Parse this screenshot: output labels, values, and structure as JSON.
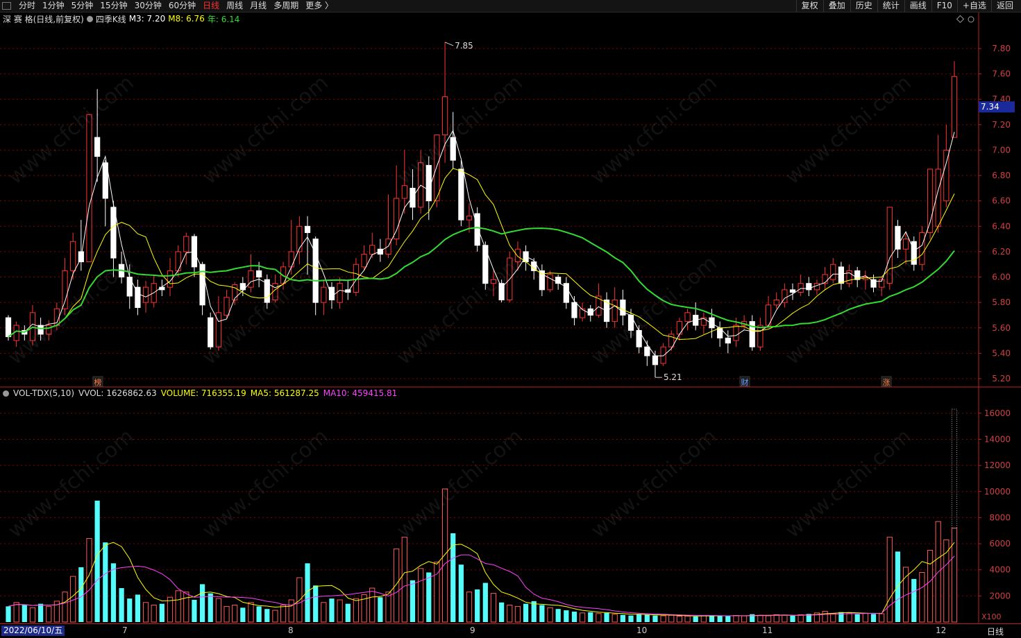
{
  "toolbar": {
    "items": [
      "分时",
      "1分钟",
      "5分钟",
      "15分钟",
      "30分钟",
      "60分钟",
      "日线",
      "周线",
      "月线",
      "多周期",
      "更多 〉"
    ],
    "active": "日线",
    "right_items": [
      "复权",
      "叠加",
      "历史",
      "统计",
      "画线",
      "F10",
      "+自选",
      "返回"
    ]
  },
  "main_info": {
    "title": "深 赛 格(日线,前复权)",
    "indicator": "四季K线",
    "m3": "M3: 7.20",
    "m8": "M8: 6.76",
    "year": "年: 6.14",
    "price_tag": "7.34",
    "high_label": "7.85",
    "low_label": "5.21",
    "badges": [
      "榜",
      "财",
      "涨"
    ]
  },
  "vol_info": {
    "name": "VOL-TDX(5,10)",
    "vvol": "VVOL: 1626862.63",
    "volume": "VOLUME: 716355.19",
    "ma5": "MA5: 561287.25",
    "ma10": "MA10: 459415.81",
    "multiplier": "X100"
  },
  "date_bar": {
    "start": "2022/06/10/五",
    "months": [
      "7",
      "8",
      "9",
      "10",
      "11",
      "12"
    ],
    "period": "日线"
  },
  "watermark": "www.cfchi.com",
  "colors": {
    "up": "#ff3232",
    "down": "#54fcfc",
    "m3": "#ffffff",
    "m8": "#ffff00",
    "year": "#32dc32",
    "grid": "#8b0000",
    "ma5": "#ffff00",
    "ma10": "#ff40ff"
  },
  "chart_data": {
    "type": "candlestick",
    "price_axis": {
      "ticks": [
        5.2,
        5.4,
        5.6,
        5.8,
        6.0,
        6.2,
        6.4,
        6.6,
        6.8,
        7.0,
        7.2,
        7.4,
        7.6,
        7.8
      ],
      "range": [
        5.14,
        7.98
      ]
    },
    "volume_axis": {
      "ticks": [
        2000,
        4000,
        6000,
        8000,
        10000,
        12000,
        14000,
        16000
      ],
      "range": [
        0,
        17000
      ],
      "unit": "X100"
    },
    "candles": [
      [
        5.68,
        5.53,
        5.7,
        5.5
      ],
      [
        5.5,
        5.62,
        5.65,
        5.45
      ],
      [
        5.58,
        5.55,
        5.62,
        5.5
      ],
      [
        5.5,
        5.72,
        5.78,
        5.46
      ],
      [
        5.62,
        5.55,
        5.68,
        5.5
      ],
      [
        5.55,
        5.62,
        5.66,
        5.5
      ],
      [
        5.62,
        5.75,
        5.8,
        5.58
      ],
      [
        5.75,
        6.05,
        6.15,
        5.7
      ],
      [
        6.05,
        6.28,
        6.35,
        5.98
      ],
      [
        6.2,
        6.12,
        6.45,
        6.05
      ],
      [
        6.12,
        7.28,
        7.28,
        6.12
      ],
      [
        7.1,
        6.95,
        7.48,
        6.75
      ],
      [
        6.9,
        6.62,
        6.92,
        6.4
      ],
      [
        6.55,
        6.15,
        6.6,
        6.0
      ],
      [
        6.1,
        6.0,
        6.2,
        5.95
      ],
      [
        6.0,
        5.85,
        6.1,
        5.75
      ],
      [
        5.92,
        5.76,
        5.98,
        5.7
      ],
      [
        5.8,
        5.92,
        5.97,
        5.72
      ],
      [
        5.8,
        5.95,
        6.02,
        5.76
      ],
      [
        5.92,
        5.9,
        5.98,
        5.85
      ],
      [
        5.92,
        6.05,
        6.15,
        5.85
      ],
      [
        6.05,
        6.2,
        6.25,
        6.0
      ],
      [
        6.2,
        6.32,
        6.35,
        6.1
      ],
      [
        6.32,
        6.08,
        6.34,
        6.0
      ],
      [
        6.1,
        5.78,
        6.12,
        5.7
      ],
      [
        5.68,
        5.45,
        5.72,
        5.43
      ],
      [
        5.45,
        5.72,
        5.85,
        5.42
      ],
      [
        5.7,
        5.84,
        5.9,
        5.68
      ],
      [
        5.82,
        5.94,
        5.96,
        5.78
      ],
      [
        5.95,
        5.9,
        6.0,
        5.85
      ],
      [
        5.92,
        6.05,
        6.18,
        5.88
      ],
      [
        6.05,
        6.0,
        6.12,
        5.92
      ],
      [
        5.98,
        5.8,
        6.02,
        5.75
      ],
      [
        5.82,
        5.95,
        6.02,
        5.8
      ],
      [
        5.95,
        6.08,
        6.12,
        5.9
      ],
      [
        6.08,
        6.2,
        6.45,
        6.02
      ],
      [
        6.2,
        6.4,
        6.48,
        6.1
      ],
      [
        6.4,
        6.35,
        6.48,
        6.02
      ],
      [
        6.3,
        5.8,
        6.32,
        5.7
      ],
      [
        5.8,
        5.92,
        5.98,
        5.7
      ],
      [
        5.92,
        5.82,
        5.96,
        5.75
      ],
      [
        5.8,
        5.95,
        6.0,
        5.75
      ],
      [
        5.9,
        5.88,
        5.98,
        5.82
      ],
      [
        5.88,
        6.1,
        6.15,
        5.85
      ],
      [
        6.08,
        6.18,
        6.25,
        6.05
      ],
      [
        6.18,
        6.25,
        6.35,
        6.15
      ],
      [
        6.22,
        6.18,
        6.3,
        6.12
      ],
      [
        6.18,
        6.3,
        6.65,
        6.15
      ],
      [
        6.3,
        6.62,
        6.88,
        6.25
      ],
      [
        6.62,
        6.72,
        7.0,
        6.5
      ],
      [
        6.7,
        6.55,
        6.85,
        6.45
      ],
      [
        6.55,
        6.9,
        7.0,
        6.5
      ],
      [
        6.88,
        6.6,
        6.95,
        6.45
      ],
      [
        6.6,
        7.12,
        7.12,
        6.55
      ],
      [
        7.12,
        7.42,
        7.85,
        6.9
      ],
      [
        7.1,
        6.92,
        7.3,
        6.85
      ],
      [
        6.85,
        6.45,
        6.92,
        6.4
      ],
      [
        6.45,
        6.48,
        6.58,
        6.35
      ],
      [
        6.5,
        6.25,
        6.55,
        6.2
      ],
      [
        6.25,
        5.95,
        6.28,
        5.9
      ],
      [
        5.95,
        5.98,
        6.05,
        5.85
      ],
      [
        5.95,
        5.82,
        5.98,
        5.8
      ],
      [
        5.82,
        6.15,
        6.2,
        5.8
      ],
      [
        6.12,
        6.22,
        6.28,
        6.05
      ],
      [
        6.2,
        6.12,
        6.25,
        6.05
      ],
      [
        6.12,
        6.05,
        6.15,
        5.98
      ],
      [
        6.05,
        5.9,
        6.1,
        5.85
      ],
      [
        5.9,
        6.02,
        6.05,
        5.88
      ],
      [
        6.0,
        5.95,
        6.02,
        5.9
      ],
      [
        5.95,
        5.8,
        6.0,
        5.75
      ],
      [
        5.8,
        5.68,
        5.85,
        5.62
      ],
      [
        5.68,
        5.75,
        5.8,
        5.65
      ],
      [
        5.75,
        5.7,
        5.78,
        5.65
      ],
      [
        5.7,
        5.85,
        5.95,
        5.68
      ],
      [
        5.82,
        5.65,
        5.88,
        5.6
      ],
      [
        5.65,
        5.82,
        5.92,
        5.6
      ],
      [
        5.82,
        5.7,
        5.9,
        5.62
      ],
      [
        5.7,
        5.58,
        5.75,
        5.52
      ],
      [
        5.58,
        5.45,
        5.62,
        5.4
      ],
      [
        5.45,
        5.38,
        5.5,
        5.3
      ],
      [
        5.38,
        5.31,
        5.42,
        5.21
      ],
      [
        5.32,
        5.45,
        5.48,
        5.3
      ],
      [
        5.45,
        5.55,
        5.58,
        5.42
      ],
      [
        5.55,
        5.65,
        5.68,
        5.5
      ],
      [
        5.65,
        5.72,
        5.75,
        5.58
      ],
      [
        5.7,
        5.62,
        5.8,
        5.58
      ],
      [
        5.62,
        5.68,
        5.72,
        5.55
      ],
      [
        5.68,
        5.6,
        5.75,
        5.52
      ],
      [
        5.6,
        5.52,
        5.65,
        5.45
      ],
      [
        5.52,
        5.48,
        5.58,
        5.4
      ],
      [
        5.5,
        5.62,
        5.68,
        5.45
      ],
      [
        5.62,
        5.65,
        5.7,
        5.58
      ],
      [
        5.65,
        5.45,
        5.7,
        5.42
      ],
      [
        5.45,
        5.62,
        5.68,
        5.42
      ],
      [
        5.62,
        5.78,
        5.85,
        5.6
      ],
      [
        5.78,
        5.82,
        5.88,
        5.75
      ],
      [
        5.8,
        5.9,
        5.95,
        5.76
      ],
      [
        5.9,
        5.88,
        5.95,
        5.82
      ],
      [
        5.88,
        5.95,
        6.02,
        5.85
      ],
      [
        5.95,
        5.9,
        6.0,
        5.85
      ],
      [
        5.9,
        5.95,
        5.98,
        5.86
      ],
      [
        5.95,
        6.02,
        6.08,
        5.9
      ],
      [
        5.98,
        6.1,
        6.15,
        5.95
      ],
      [
        6.08,
        5.95,
        6.12,
        5.9
      ],
      [
        5.95,
        6.05,
        6.1,
        5.92
      ],
      [
        6.05,
        5.98,
        6.08,
        5.92
      ],
      [
        5.98,
        6.0,
        6.05,
        5.9
      ],
      [
        5.98,
        5.92,
        6.02,
        5.88
      ],
      [
        5.92,
        5.98,
        6.0,
        5.85
      ],
      [
        5.95,
        6.55,
        6.55,
        5.9
      ],
      [
        6.4,
        6.22,
        6.45,
        6.15
      ],
      [
        6.22,
        6.3,
        6.35,
        6.1
      ],
      [
        6.28,
        6.1,
        6.32,
        6.05
      ],
      [
        6.1,
        6.35,
        6.4,
        6.05
      ],
      [
        6.35,
        6.85,
        6.85,
        6.3
      ],
      [
        6.4,
        6.85,
        7.12,
        6.35
      ],
      [
        6.6,
        7.0,
        7.2,
        6.55
      ],
      [
        7.1,
        7.58,
        7.7,
        7.1
      ]
    ],
    "volumes": [
      1200,
      1500,
      1300,
      1100,
      1400,
      1200,
      1600,
      2300,
      3500,
      4200,
      6400,
      9300,
      6100,
      4500,
      2600,
      1800,
      2100,
      1500,
      1300,
      1400,
      1900,
      2400,
      2300,
      1700,
      2900,
      2200,
      1800,
      1200,
      1300,
      1100,
      1500,
      1200,
      1000,
      900,
      1300,
      1700,
      3400,
      4500,
      2800,
      1500,
      1800,
      1700,
      1400,
      1800,
      2100,
      2600,
      1900,
      2300,
      5600,
      6500,
      3200,
      4100,
      3800,
      4600,
      10200,
      6800,
      4400,
      2300,
      2500,
      3000,
      2200,
      1500,
      1300,
      1200,
      1400,
      1600,
      1300,
      1100,
      1000,
      900,
      800,
      700,
      750,
      650,
      700,
      600,
      550,
      500,
      620,
      580,
      500,
      480,
      520,
      450,
      460,
      430,
      500,
      520,
      480,
      450,
      500,
      470,
      600,
      520,
      480,
      560,
      520,
      500,
      560,
      620,
      700,
      820,
      650,
      760,
      700,
      600,
      680,
      620,
      640,
      6500,
      5400,
      4200,
      3300,
      3800,
      5500,
      7700,
      6300,
      7200
    ]
  }
}
